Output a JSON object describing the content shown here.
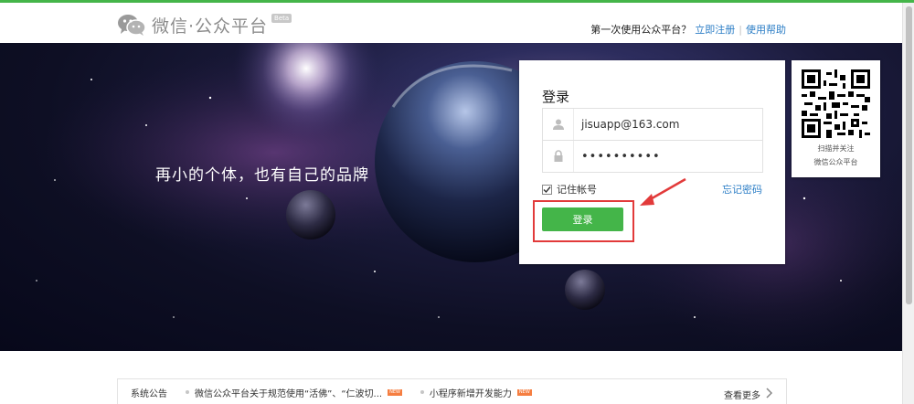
{
  "header": {
    "logo_text": "微信·公众平台",
    "beta_badge": "Beta",
    "question": "第一次使用公众平台？",
    "register_link": "立即注册",
    "separator": "|",
    "help_link": "使用帮助"
  },
  "hero": {
    "slogan": "再小的个体，也有自己的品牌"
  },
  "login": {
    "title": "登录",
    "username_value": "jisuapp@163.com",
    "password_value": "••••••••••",
    "remember_label": "记住帐号",
    "remember_checked": true,
    "forgot_link": "忘记密码",
    "submit_label": "登录"
  },
  "qr": {
    "line1": "扫描并关注",
    "line2": "微信公众平台"
  },
  "notice": {
    "title": "系统公告",
    "items": [
      {
        "text": "微信公众平台关于规范使用“活佛”、“仁波切...",
        "badge": "NEW"
      },
      {
        "text": "小程序新增开发能力",
        "badge": "NEW"
      }
    ],
    "more_label": "查看更多"
  },
  "colors": {
    "brand_green": "#44b549",
    "link_blue": "#2c7ec6",
    "highlight_red": "#e23a3a"
  },
  "icons": [
    "wechat-logo-icon",
    "user-icon",
    "lock-icon",
    "checkbox-check-icon",
    "red-arrow-icon",
    "qr-code",
    "chevron-right-icon"
  ]
}
